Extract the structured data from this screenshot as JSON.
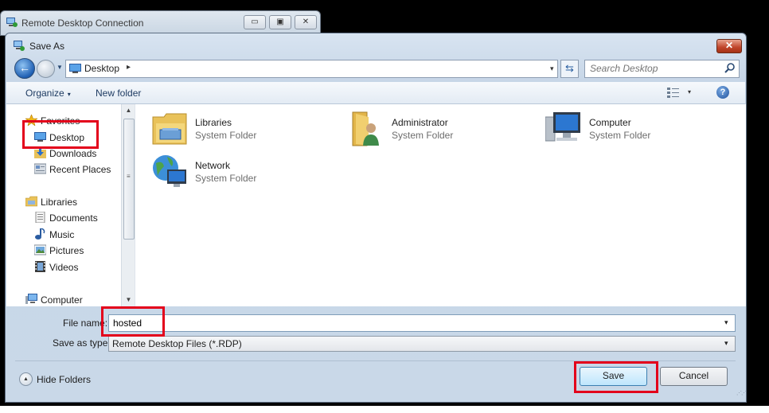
{
  "parent_window": {
    "title": "Remote Desktop Connection",
    "minimize": "▭",
    "maximize": "▣",
    "close": "✕"
  },
  "dialog": {
    "title": "Save As",
    "close": "✕"
  },
  "address": {
    "location": "Desktop",
    "chevron": "▸",
    "dropdown": "▾",
    "refresh": "⇆",
    "search_placeholder": "Search Desktop"
  },
  "toolbar": {
    "organize": "Organize",
    "organize_arrow": "▾",
    "new_folder": "New folder",
    "views_arrow": "▾",
    "help": "?"
  },
  "nav_pane": {
    "items": [
      {
        "label": "Favorites",
        "icon": "star-icon"
      },
      {
        "label": "Desktop",
        "icon": "desktop-icon"
      },
      {
        "label": "Downloads",
        "icon": "downloads-icon"
      },
      {
        "label": "Recent Places",
        "icon": "recent-places-icon"
      },
      {
        "label": "Libraries",
        "icon": "libraries-icon"
      },
      {
        "label": "Documents",
        "icon": "documents-icon"
      },
      {
        "label": "Music",
        "icon": "music-icon"
      },
      {
        "label": "Pictures",
        "icon": "pictures-icon"
      },
      {
        "label": "Videos",
        "icon": "videos-icon"
      },
      {
        "label": "Computer",
        "icon": "computer-icon"
      }
    ]
  },
  "content": {
    "items": [
      {
        "name": "Libraries",
        "desc": "System Folder",
        "icon": "libraries-folder-icon"
      },
      {
        "name": "Administrator",
        "desc": "System Folder",
        "icon": "user-folder-icon"
      },
      {
        "name": "Computer",
        "desc": "System Folder",
        "icon": "computer-icon"
      },
      {
        "name": "Network",
        "desc": "System Folder",
        "icon": "network-icon"
      }
    ]
  },
  "form": {
    "file_name_label": "File name:",
    "file_name_value": "hosted",
    "save_type_label": "Save as type:",
    "save_type_value": "Remote Desktop Files (*.RDP)",
    "dropdown": "▾"
  },
  "bottom": {
    "hide_folders": "Hide Folders",
    "hide_arrow": "▲",
    "save": "Save",
    "cancel": "Cancel"
  },
  "colors": {
    "highlight": "#e3001b",
    "accent": "#1f5fb3"
  }
}
